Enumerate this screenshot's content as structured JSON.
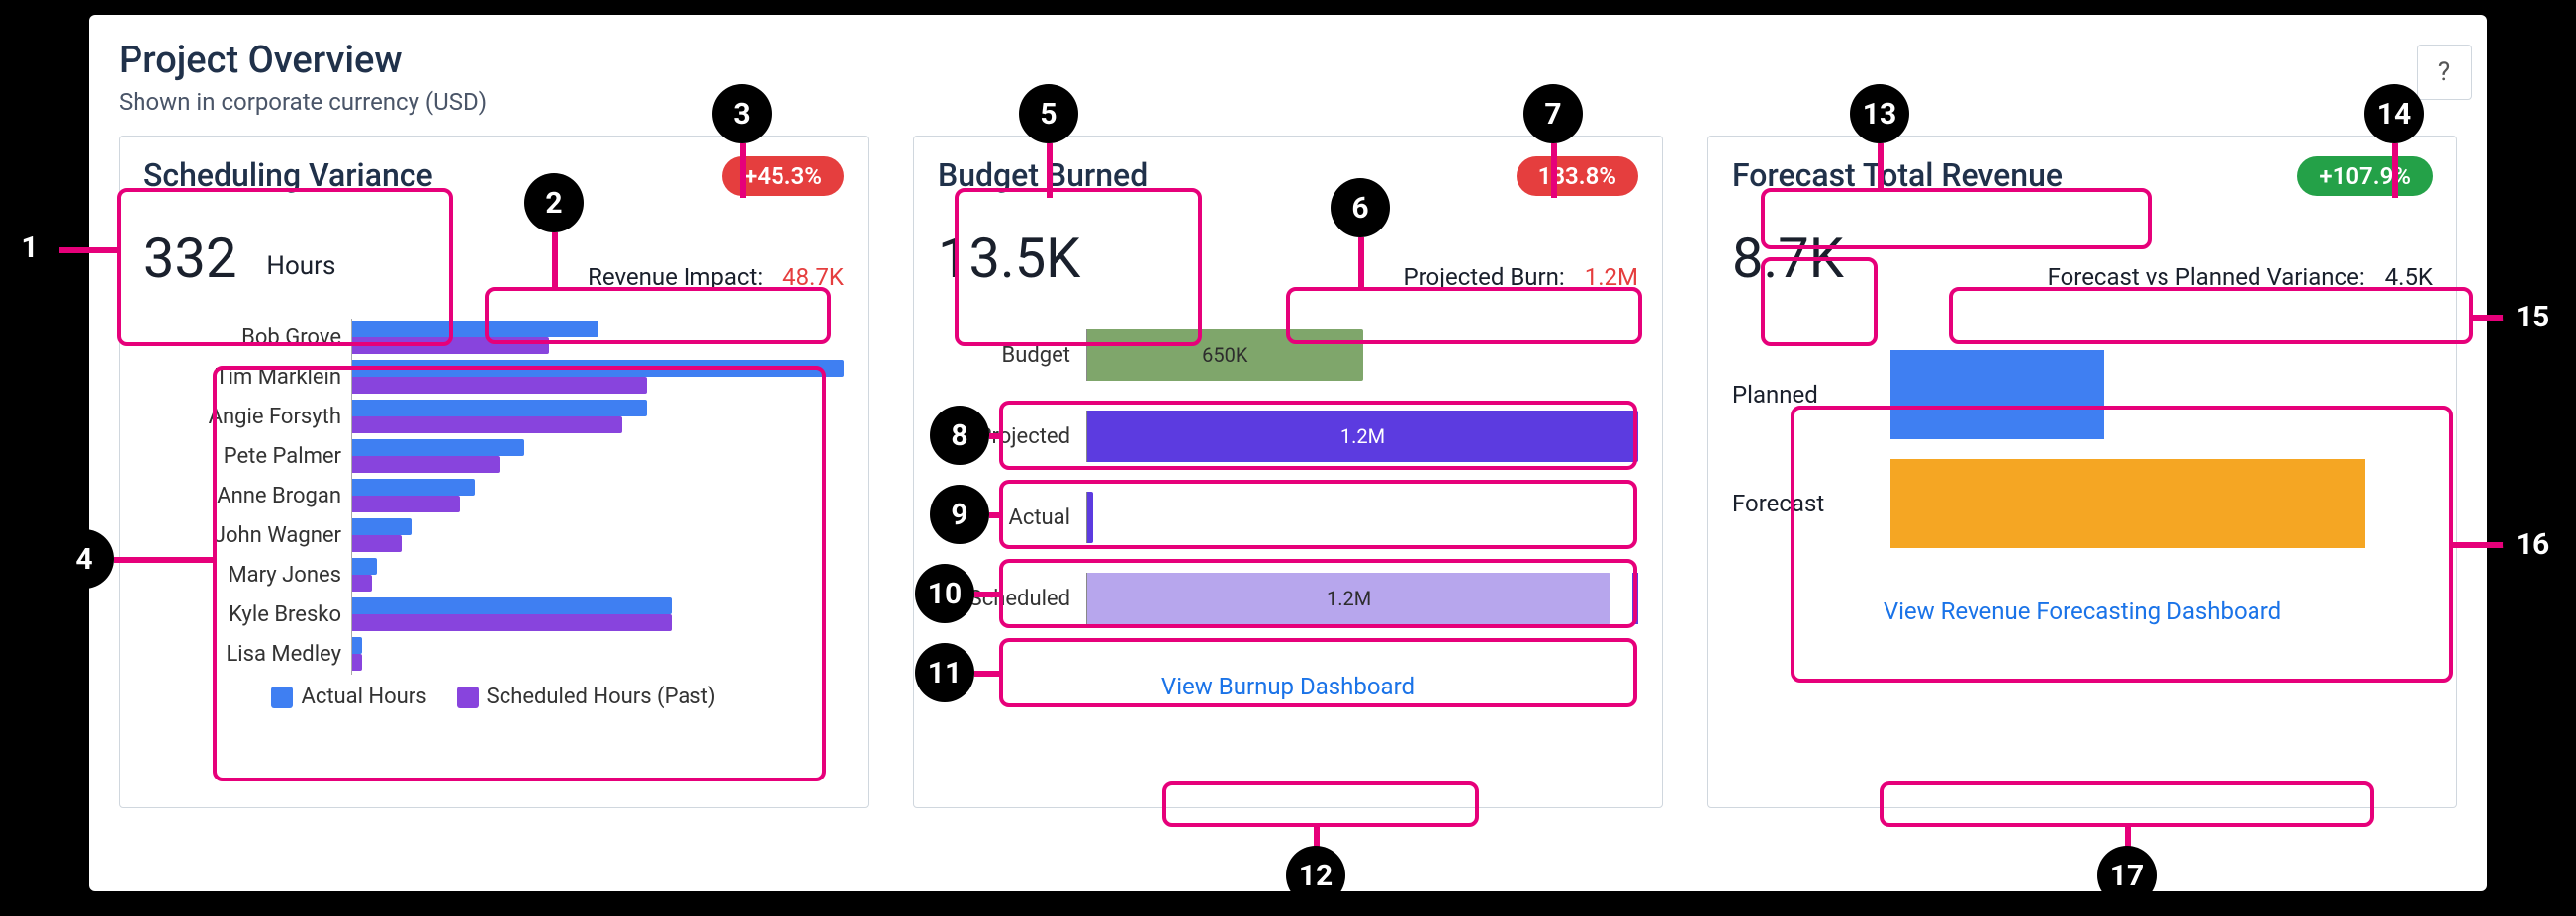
{
  "header": {
    "title": "Project Overview",
    "subtitle": "Shown in corporate currency (USD)",
    "help": "?"
  },
  "cards": {
    "scheduling": {
      "title": "Scheduling Variance",
      "value": "332",
      "unit": "Hours",
      "badge": "+45.3%",
      "sub_label": "Revenue Impact:",
      "sub_value": "48.7K",
      "legend_actual": "Actual Hours",
      "legend_scheduled": "Scheduled Hours (Past)",
      "people": [
        {
          "name": "Bob Grove",
          "actual": 50,
          "scheduled": 40
        },
        {
          "name": "Tim Marklein",
          "actual": 100,
          "scheduled": 60
        },
        {
          "name": "Angie Forsyth",
          "actual": 60,
          "scheduled": 55
        },
        {
          "name": "Pete Palmer",
          "actual": 35,
          "scheduled": 30
        },
        {
          "name": "Anne Brogan",
          "actual": 25,
          "scheduled": 22
        },
        {
          "name": "John Wagner",
          "actual": 12,
          "scheduled": 10
        },
        {
          "name": "Mary Jones",
          "actual": 5,
          "scheduled": 4
        },
        {
          "name": "Kyle Bresko",
          "actual": 65,
          "scheduled": 65
        },
        {
          "name": "Lisa Medley",
          "actual": 2,
          "scheduled": 2
        }
      ],
      "axis_max": 100
    },
    "budget": {
      "title": "Budget Burned",
      "value": "13.5K",
      "badge": "183.8%",
      "sub_label": "Projected Burn:",
      "sub_value": "1.2M",
      "rows": {
        "budget": {
          "label": "Budget",
          "value": "650K",
          "pct": 50
        },
        "projected": {
          "label": "Projected",
          "value": "1.2M",
          "pct": 100
        },
        "actual": {
          "label": "Actual",
          "value": "",
          "pct": 1
        },
        "scheduled": {
          "label": "Scheduled",
          "value": "1.2M",
          "pct": 95
        }
      },
      "link": "View Burnup Dashboard"
    },
    "forecast": {
      "title": "Forecast Total Revenue",
      "value": "8.7K",
      "badge": "+107.9%",
      "sub_label": "Forecast vs Planned Variance:",
      "sub_value": "4.5K",
      "rows": {
        "planned": {
          "label": "Planned",
          "pct": 45
        },
        "forecast": {
          "label": "Forecast",
          "pct": 100
        }
      },
      "link": "View Revenue Forecasting Dashboard"
    }
  },
  "markers": {
    "m1": "1",
    "m2": "2",
    "m3": "3",
    "m4": "4",
    "m5": "5",
    "m6": "6",
    "m7": "7",
    "m8": "8",
    "m9": "9",
    "m10": "10",
    "m11": "11",
    "m12": "12",
    "m13": "13",
    "m14": "14",
    "m15": "15",
    "m16": "16",
    "m17": "17"
  },
  "chart_data": [
    {
      "type": "bar",
      "title": "Scheduling Variance",
      "orientation": "horizontal",
      "categories": [
        "Bob Grove",
        "Tim Marklein",
        "Angie Forsyth",
        "Pete Palmer",
        "Anne Brogan",
        "John Wagner",
        "Mary Jones",
        "Kyle Bresko",
        "Lisa Medley"
      ],
      "series": [
        {
          "name": "Actual Hours",
          "values": [
            50,
            100,
            60,
            35,
            25,
            12,
            5,
            65,
            2
          ]
        },
        {
          "name": "Scheduled Hours (Past)",
          "values": [
            40,
            60,
            55,
            30,
            22,
            10,
            4,
            65,
            2
          ]
        }
      ],
      "xlabel": "",
      "ylabel": "",
      "xlim": [
        0,
        100
      ]
    },
    {
      "type": "bar",
      "title": "Budget Burned",
      "orientation": "horizontal",
      "categories": [
        "Budget",
        "Projected",
        "Actual",
        "Scheduled"
      ],
      "values_label": [
        "650K",
        "1.2M",
        "",
        "1.2M"
      ],
      "values": [
        650000,
        1200000,
        13500,
        1200000
      ],
      "xlim": [
        0,
        1200000
      ]
    },
    {
      "type": "bar",
      "title": "Forecast Total Revenue",
      "orientation": "horizontal",
      "categories": [
        "Planned",
        "Forecast"
      ],
      "values": [
        4200,
        8700
      ],
      "xlim": [
        0,
        8700
      ]
    }
  ]
}
